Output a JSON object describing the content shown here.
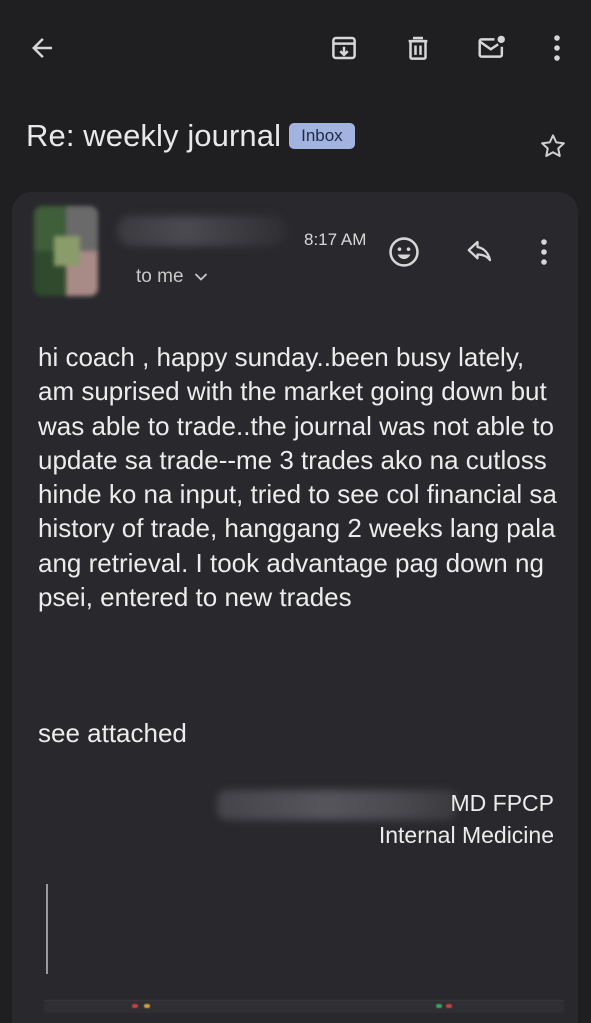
{
  "subject": "Re: weekly journal",
  "label": "Inbox",
  "message": {
    "time": "8:17 AM",
    "recipient": "to me",
    "body": "hi coach , happy sunday..been busy lately, am suprised with the market going down but was able to trade..the journal was not able to update sa trade--me 3 trades ako na cutloss hinde ko na input, tried to see col financial sa history of trade, hanggang 2 weeks lang pala ang retrieval. I took advantage pag down ng psei, entered to new trades",
    "closing": "see attached",
    "signature_line1": "MD FPCP",
    "signature_line2": "Internal Medicine"
  },
  "icons": {
    "back": "arrow-back-icon",
    "archive": "archive-icon",
    "delete": "trash-icon",
    "mark_unread": "mail-unread-icon",
    "more": "more-vert-icon",
    "star": "star-outline-icon",
    "emoji": "emoji-reaction-icon",
    "reply": "reply-icon",
    "expand": "chevron-down-icon"
  },
  "colors": {
    "background": "#1f1f22",
    "card": "#29292d",
    "label_chip": "#a3b3e0",
    "text": "#ececec"
  }
}
